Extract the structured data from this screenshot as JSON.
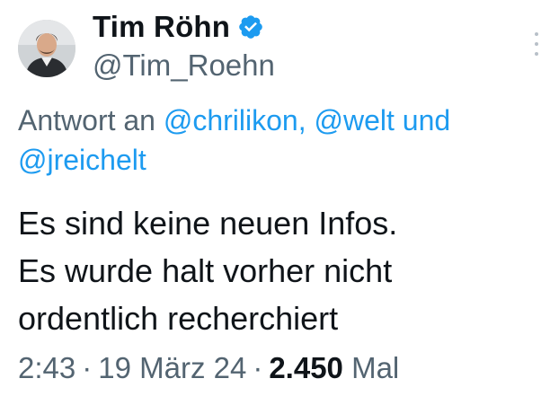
{
  "author": {
    "display_name": "Tim Röhn",
    "handle": "@Tim_Roehn",
    "verified_icon": "verified-badge-icon",
    "avatar_icon": "profile-avatar"
  },
  "reply": {
    "prefix": "Antwort an",
    "mention_1": "@chrilikon,",
    "mention_2": "@welt",
    "conjunction": "und",
    "mention_3": "@jreichelt"
  },
  "tweet": {
    "lines": [
      "Es sind keine neuen Infos.",
      "Es wurde halt vorher nicht",
      "ordentlich recherchiert"
    ]
  },
  "meta": {
    "time": "2:43",
    "separator": "·",
    "date": "19 März 24",
    "views_count": "2.450",
    "views_label": "Mal"
  },
  "colors": {
    "link": "#1d9bf0",
    "secondary_text": "#536471",
    "primary_text": "#0f1419",
    "verified": "#1d9bf0"
  }
}
